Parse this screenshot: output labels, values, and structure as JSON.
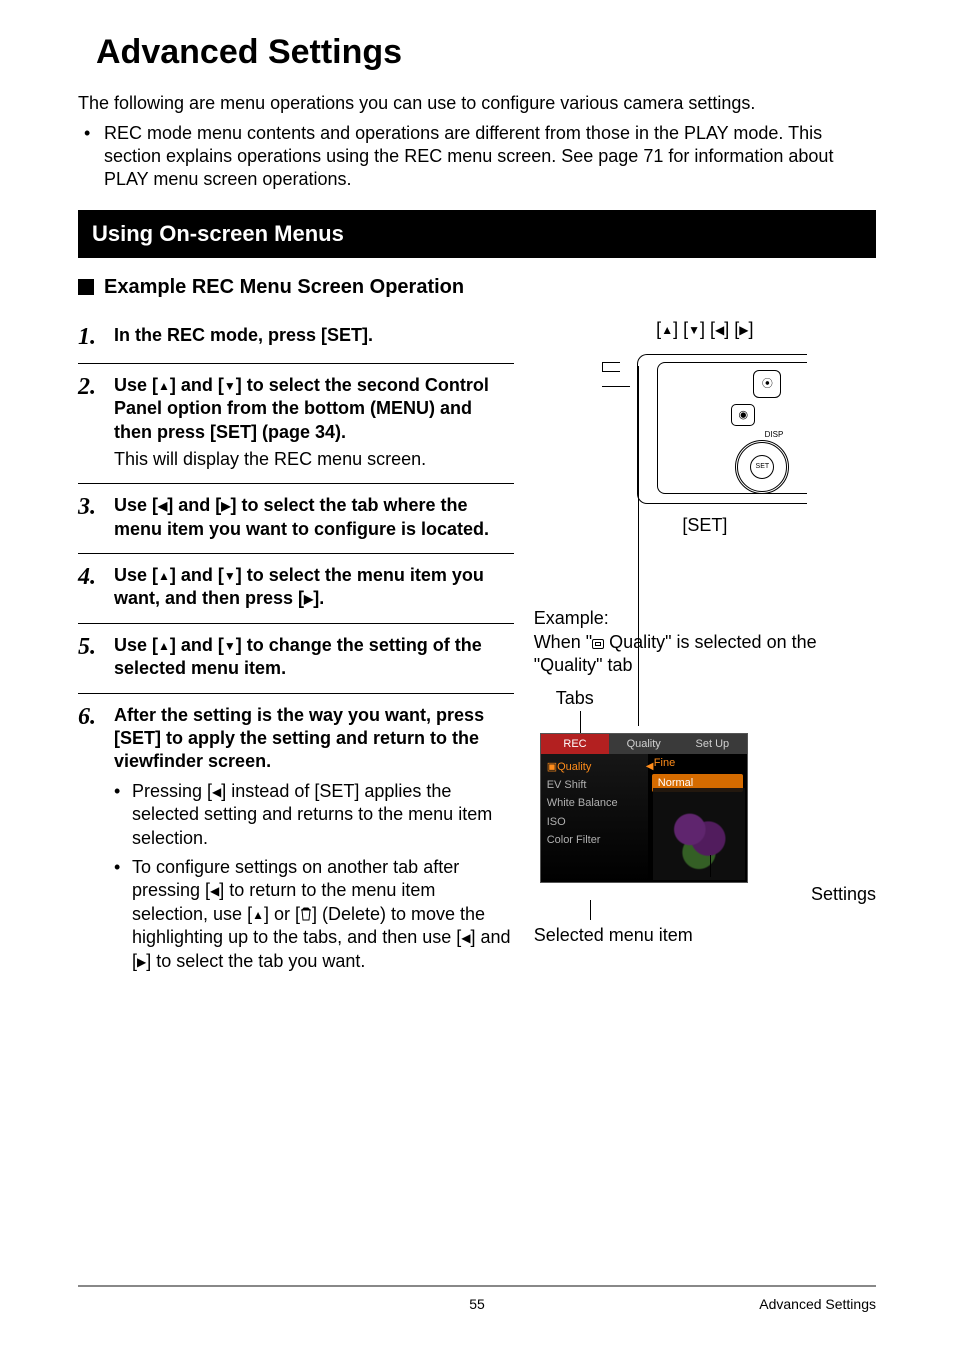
{
  "title": "Advanced Settings",
  "intro": "The following are menu operations you can use to configure various camera settings.",
  "intro_bullet": "REC mode menu contents and operations are different from those in the PLAY mode. This section explains operations using the REC menu screen. See page 71 for information about PLAY menu screen operations.",
  "section": "Using On-screen Menus",
  "subheading": "Example REC Menu Screen Operation",
  "steps": {
    "s1": {
      "num": "1.",
      "strong": "In the REC mode, press [SET]."
    },
    "s2": {
      "num": "2.",
      "strong_a": "Use [",
      "strong_b": "] and [",
      "strong_c": "] to select the second Control Panel option from the bottom (MENU) and then press [SET] (page 34).",
      "note": "This will display the REC menu screen."
    },
    "s3": {
      "num": "3.",
      "strong_a": "Use [",
      "strong_b": "] and [",
      "strong_c": "] to select the tab where the menu item you want to configure is located."
    },
    "s4": {
      "num": "4.",
      "strong_a": "Use [",
      "strong_b": "] and [",
      "strong_c": "] to select the menu item you want, and then press [",
      "strong_d": "]."
    },
    "s5": {
      "num": "5.",
      "strong_a": "Use [",
      "strong_b": "] and [",
      "strong_c": "] to change the setting of the selected menu item."
    },
    "s6": {
      "num": "6.",
      "strong": "After the setting is the way you want, press [SET] to apply the setting and return to the viewfinder screen.",
      "b1_a": "Pressing [",
      "b1_b": "] instead of [SET] applies the selected setting and returns to the menu item selection.",
      "b2_a": "To configure settings on another tab after pressing [",
      "b2_b": "] to return to the menu item selection, use [",
      "b2_c": "] or [",
      "b2_d": "] (Delete) to move the highlighting up to the tabs, and then use [",
      "b2_e": "] and [",
      "b2_f": "] to select the tab you want."
    }
  },
  "right": {
    "arrows_label_a": "[",
    "arrows_label_b": "] [",
    "arrows_label_c": "] [",
    "arrows_label_d": "] [",
    "arrows_label_e": "]",
    "set_label": "[SET]",
    "example_a": "Example:",
    "example_b_a": "When \"",
    "example_b_b": " Quality\" is selected on the \"Quality\" tab",
    "tabs_label": "Tabs",
    "settings_label": "Settings",
    "selected_label": "Selected menu item"
  },
  "menu": {
    "tab_rec": "REC",
    "tab_quality": "Quality",
    "tab_setup": "Set Up",
    "item_quality": "Quality",
    "item_ev": "EV Shift",
    "item_wb": "White Balance",
    "item_iso": "ISO",
    "item_cf": "Color Filter",
    "opt_fine": "Fine",
    "opt_normal": "Normal"
  },
  "footer": {
    "page": "55",
    "section": "Advanced Settings"
  }
}
